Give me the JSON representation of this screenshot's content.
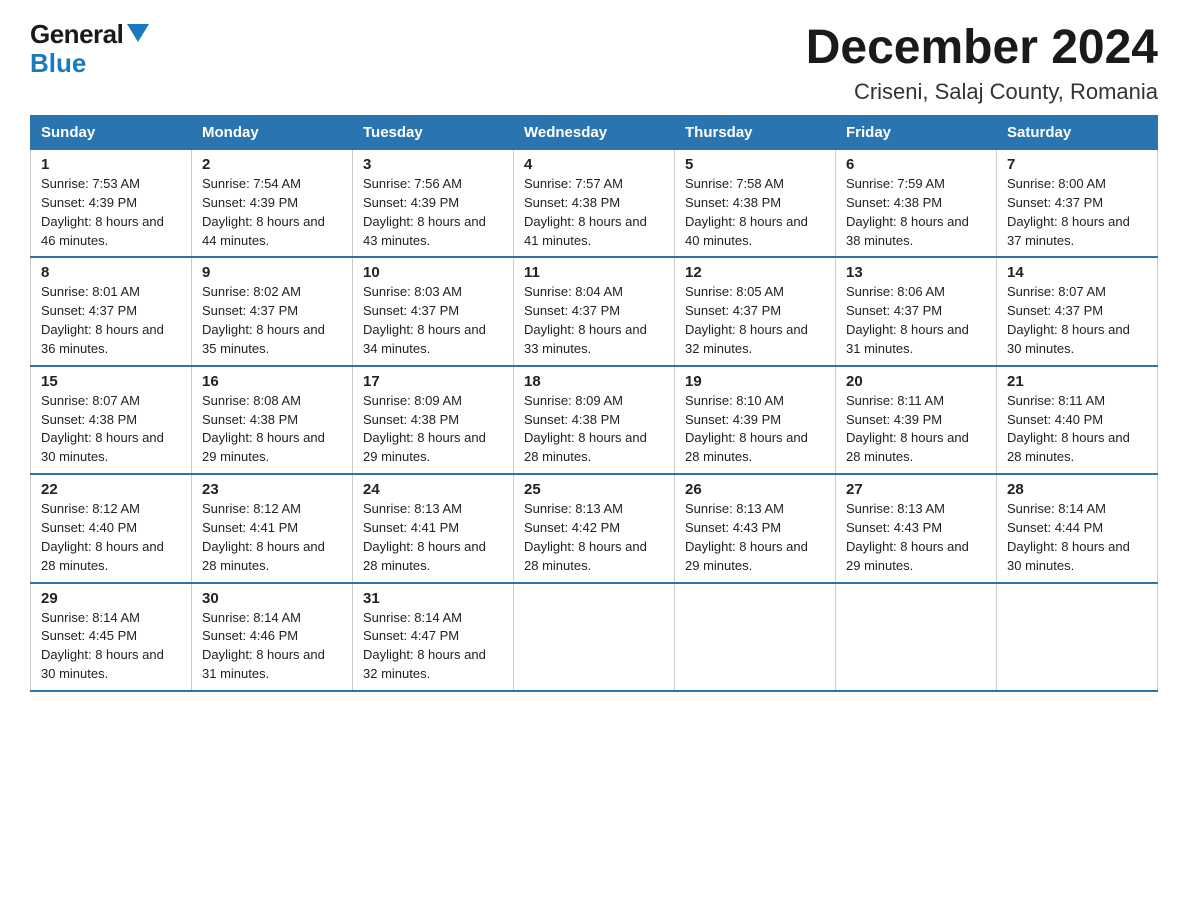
{
  "logo": {
    "line1": "General",
    "line2": "Blue"
  },
  "title": "December 2024",
  "subtitle": "Criseni, Salaj County, Romania",
  "days_header": [
    "Sunday",
    "Monday",
    "Tuesday",
    "Wednesday",
    "Thursday",
    "Friday",
    "Saturday"
  ],
  "weeks": [
    [
      {
        "num": "1",
        "sunrise": "7:53 AM",
        "sunset": "4:39 PM",
        "daylight": "8 hours and 46 minutes."
      },
      {
        "num": "2",
        "sunrise": "7:54 AM",
        "sunset": "4:39 PM",
        "daylight": "8 hours and 44 minutes."
      },
      {
        "num": "3",
        "sunrise": "7:56 AM",
        "sunset": "4:39 PM",
        "daylight": "8 hours and 43 minutes."
      },
      {
        "num": "4",
        "sunrise": "7:57 AM",
        "sunset": "4:38 PM",
        "daylight": "8 hours and 41 minutes."
      },
      {
        "num": "5",
        "sunrise": "7:58 AM",
        "sunset": "4:38 PM",
        "daylight": "8 hours and 40 minutes."
      },
      {
        "num": "6",
        "sunrise": "7:59 AM",
        "sunset": "4:38 PM",
        "daylight": "8 hours and 38 minutes."
      },
      {
        "num": "7",
        "sunrise": "8:00 AM",
        "sunset": "4:37 PM",
        "daylight": "8 hours and 37 minutes."
      }
    ],
    [
      {
        "num": "8",
        "sunrise": "8:01 AM",
        "sunset": "4:37 PM",
        "daylight": "8 hours and 36 minutes."
      },
      {
        "num": "9",
        "sunrise": "8:02 AM",
        "sunset": "4:37 PM",
        "daylight": "8 hours and 35 minutes."
      },
      {
        "num": "10",
        "sunrise": "8:03 AM",
        "sunset": "4:37 PM",
        "daylight": "8 hours and 34 minutes."
      },
      {
        "num": "11",
        "sunrise": "8:04 AM",
        "sunset": "4:37 PM",
        "daylight": "8 hours and 33 minutes."
      },
      {
        "num": "12",
        "sunrise": "8:05 AM",
        "sunset": "4:37 PM",
        "daylight": "8 hours and 32 minutes."
      },
      {
        "num": "13",
        "sunrise": "8:06 AM",
        "sunset": "4:37 PM",
        "daylight": "8 hours and 31 minutes."
      },
      {
        "num": "14",
        "sunrise": "8:07 AM",
        "sunset": "4:37 PM",
        "daylight": "8 hours and 30 minutes."
      }
    ],
    [
      {
        "num": "15",
        "sunrise": "8:07 AM",
        "sunset": "4:38 PM",
        "daylight": "8 hours and 30 minutes."
      },
      {
        "num": "16",
        "sunrise": "8:08 AM",
        "sunset": "4:38 PM",
        "daylight": "8 hours and 29 minutes."
      },
      {
        "num": "17",
        "sunrise": "8:09 AM",
        "sunset": "4:38 PM",
        "daylight": "8 hours and 29 minutes."
      },
      {
        "num": "18",
        "sunrise": "8:09 AM",
        "sunset": "4:38 PM",
        "daylight": "8 hours and 28 minutes."
      },
      {
        "num": "19",
        "sunrise": "8:10 AM",
        "sunset": "4:39 PM",
        "daylight": "8 hours and 28 minutes."
      },
      {
        "num": "20",
        "sunrise": "8:11 AM",
        "sunset": "4:39 PM",
        "daylight": "8 hours and 28 minutes."
      },
      {
        "num": "21",
        "sunrise": "8:11 AM",
        "sunset": "4:40 PM",
        "daylight": "8 hours and 28 minutes."
      }
    ],
    [
      {
        "num": "22",
        "sunrise": "8:12 AM",
        "sunset": "4:40 PM",
        "daylight": "8 hours and 28 minutes."
      },
      {
        "num": "23",
        "sunrise": "8:12 AM",
        "sunset": "4:41 PM",
        "daylight": "8 hours and 28 minutes."
      },
      {
        "num": "24",
        "sunrise": "8:13 AM",
        "sunset": "4:41 PM",
        "daylight": "8 hours and 28 minutes."
      },
      {
        "num": "25",
        "sunrise": "8:13 AM",
        "sunset": "4:42 PM",
        "daylight": "8 hours and 28 minutes."
      },
      {
        "num": "26",
        "sunrise": "8:13 AM",
        "sunset": "4:43 PM",
        "daylight": "8 hours and 29 minutes."
      },
      {
        "num": "27",
        "sunrise": "8:13 AM",
        "sunset": "4:43 PM",
        "daylight": "8 hours and 29 minutes."
      },
      {
        "num": "28",
        "sunrise": "8:14 AM",
        "sunset": "4:44 PM",
        "daylight": "8 hours and 30 minutes."
      }
    ],
    [
      {
        "num": "29",
        "sunrise": "8:14 AM",
        "sunset": "4:45 PM",
        "daylight": "8 hours and 30 minutes."
      },
      {
        "num": "30",
        "sunrise": "8:14 AM",
        "sunset": "4:46 PM",
        "daylight": "8 hours and 31 minutes."
      },
      {
        "num": "31",
        "sunrise": "8:14 AM",
        "sunset": "4:47 PM",
        "daylight": "8 hours and 32 minutes."
      },
      null,
      null,
      null,
      null
    ]
  ]
}
